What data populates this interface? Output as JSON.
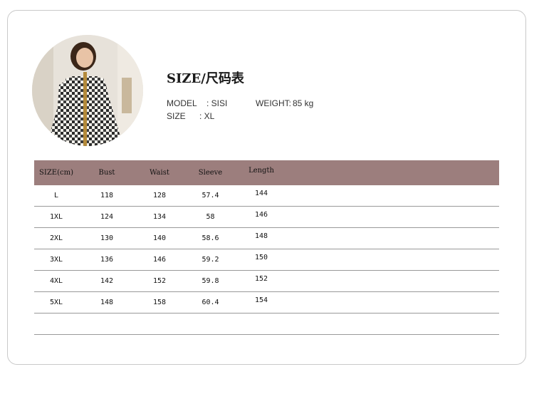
{
  "title": "SIZE/尺码表",
  "model": {
    "label": "MODEL",
    "value": ": SISI"
  },
  "weight": {
    "label": "WEIGHT:",
    "value": "85 kg"
  },
  "size": {
    "label": "SIZE",
    "value": ":   XL"
  },
  "table": {
    "headers": [
      "SIZE(cm)",
      "Bust",
      "Waist",
      "Sleeve",
      "Length"
    ],
    "rows": [
      [
        "L",
        "118",
        "128",
        "57.4",
        "144"
      ],
      [
        "1XL",
        "124",
        "134",
        "58",
        "146"
      ],
      [
        "2XL",
        "130",
        "140",
        "58.6",
        "148"
      ],
      [
        "3XL",
        "136",
        "146",
        "59.2",
        "150"
      ],
      [
        "4XL",
        "142",
        "152",
        "59.8",
        "152"
      ],
      [
        "5XL",
        "148",
        "158",
        "60.4",
        "154"
      ],
      [
        "",
        "",
        "",
        "",
        ""
      ]
    ]
  },
  "colors": {
    "header_bg": "#9c7e7d",
    "border": "#999999"
  }
}
